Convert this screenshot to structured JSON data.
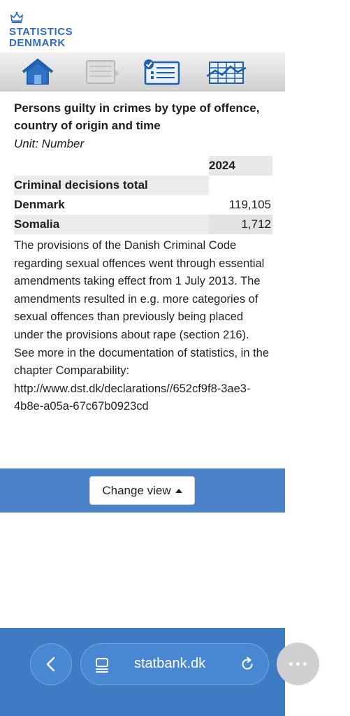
{
  "logo": {
    "line1": "STATISTICS",
    "line2": "DENMARK"
  },
  "toolbar": {
    "icons": [
      "home-icon",
      "document-next-icon",
      "checklist-icon",
      "chart-table-icon"
    ]
  },
  "table": {
    "title": "Persons guilty in crimes by type of offence, country of origin and time",
    "unit": "Unit: Number",
    "column_header": "2024",
    "section": "Criminal decisions total",
    "rows": [
      {
        "label": "Denmark",
        "value": "119,105"
      },
      {
        "label": "Somalia",
        "value": "1,712"
      }
    ]
  },
  "note": "The provisions of the Danish Criminal Code regarding sexual offences went through essential amendments taking effect from 1 July 2013. The amendments resulted in e.g. more categories of sexual offences than previously being placed under the provisions about rape (section 216). See more in the documentation of statistics, in the chapter Comparability:",
  "note_url": "http://www.dst.dk/declarations//652cf9f8-3ae3-4b8e-a05a-67c67b0923cd",
  "change_view": {
    "label": "Change view"
  },
  "browser": {
    "url": "statbank.dk"
  },
  "colors": {
    "brand": "#2f6bbf",
    "band": "#4a82c8",
    "bottom_bar": "#3f7ac4"
  }
}
